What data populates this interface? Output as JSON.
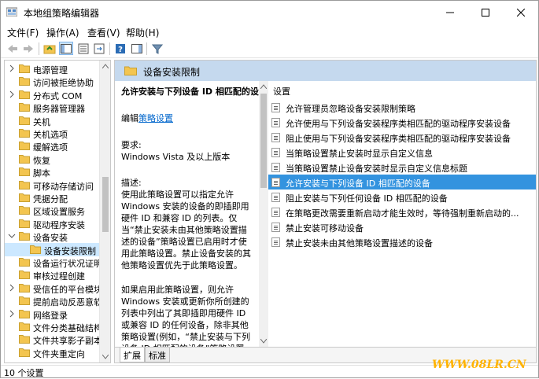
{
  "window": {
    "title": "本地组策略编辑器"
  },
  "menu": [
    "文件(F)",
    "操作(A)",
    "查看(V)",
    "帮助(H)"
  ],
  "tree": [
    {
      "label": "电源管理",
      "expander": "right",
      "indent": 0
    },
    {
      "label": "访问被拒绝协助",
      "expander": "none",
      "indent": 0
    },
    {
      "label": "分布式 COM",
      "expander": "right",
      "indent": 0
    },
    {
      "label": "服务器管理器",
      "expander": "none",
      "indent": 0
    },
    {
      "label": "关机",
      "expander": "none",
      "indent": 0
    },
    {
      "label": "关机选项",
      "expander": "none",
      "indent": 0
    },
    {
      "label": "缓解选项",
      "expander": "none",
      "indent": 0
    },
    {
      "label": "恢复",
      "expander": "none",
      "indent": 0
    },
    {
      "label": "脚本",
      "expander": "none",
      "indent": 0
    },
    {
      "label": "可移动存储访问",
      "expander": "none",
      "indent": 0
    },
    {
      "label": "凭据分配",
      "expander": "none",
      "indent": 0
    },
    {
      "label": "区域设置服务",
      "expander": "none",
      "indent": 0
    },
    {
      "label": "驱动程序安装",
      "expander": "none",
      "indent": 0
    },
    {
      "label": "设备安装",
      "expander": "down",
      "indent": 0
    },
    {
      "label": "设备安装限制",
      "expander": "none",
      "indent": 1,
      "selected": true
    },
    {
      "label": "设备运行状况证明",
      "expander": "none",
      "indent": 0
    },
    {
      "label": "审核过程创建",
      "expander": "none",
      "indent": 0
    },
    {
      "label": "受信任的平台模块",
      "expander": "right",
      "indent": 0
    },
    {
      "label": "提前启动反恶意软",
      "expander": "none",
      "indent": 0
    },
    {
      "label": "网络登录",
      "expander": "right",
      "indent": 0
    },
    {
      "label": "文件分类基础结构",
      "expander": "none",
      "indent": 0
    },
    {
      "label": "文件共享影子副本",
      "expander": "none",
      "indent": 0
    },
    {
      "label": "文件夹重定向",
      "expander": "none",
      "indent": 0
    }
  ],
  "right": {
    "header": "设备安装限制",
    "desc_title": "允许安装与下列设备 ID 相匹配的设备",
    "edit_prefix": "编辑",
    "edit_link": "策略设置",
    "req_label": "要求:",
    "req_value": "Windows Vista 及以上版本",
    "desc_label": "描述:",
    "desc_body": "使用此策略设置可以指定允许 Windows 安装的设备的即插即用硬件 ID 和兼容 ID 的列表。仅当“禁止安装未由其他策略设置描述的设备”策略设置已启用时才使用此策略设置。禁止设备安装的其他策略设置优先于此策略设置。",
    "desc_body2": "如果启用此策略设置，则允许 Windows 安装或更新你所创建的列表中列出了其即插即用硬件 ID 或兼容 ID 的任何设备，除非其他策略设置(例如，“禁止安装与下列设备 ID 相匹配的设备”策略设置",
    "column": "设置",
    "items": [
      "允许管理员忽略设备安装限制策略",
      "允许使用与下列设备安装程序类相匹配的驱动程序安装设备",
      "阻止使用与下列设备安装程序类相匹配的驱动程序安装设备",
      "当策略设置禁止安装时显示自定义信息",
      "当策略设置禁止设备安装时显示自定义信息标题",
      "允许安装与下列设备 ID 相匹配的设备",
      "阻止安装与下列任何设备 ID 相匹配的设备",
      "在策略更改需要重新启动才能生效时，等待强制重新启动的...",
      "禁止安装可移动设备",
      "禁止安装未由其他策略设置描述的设备"
    ],
    "selected_index": 5,
    "tabs": [
      "扩展",
      "标准"
    ]
  },
  "status": "10 个设置",
  "watermark": "WWW.08LR.CN",
  "colors": {
    "selection": "#3393df",
    "header": "#c5d9ee",
    "folder": "#f3c550"
  }
}
